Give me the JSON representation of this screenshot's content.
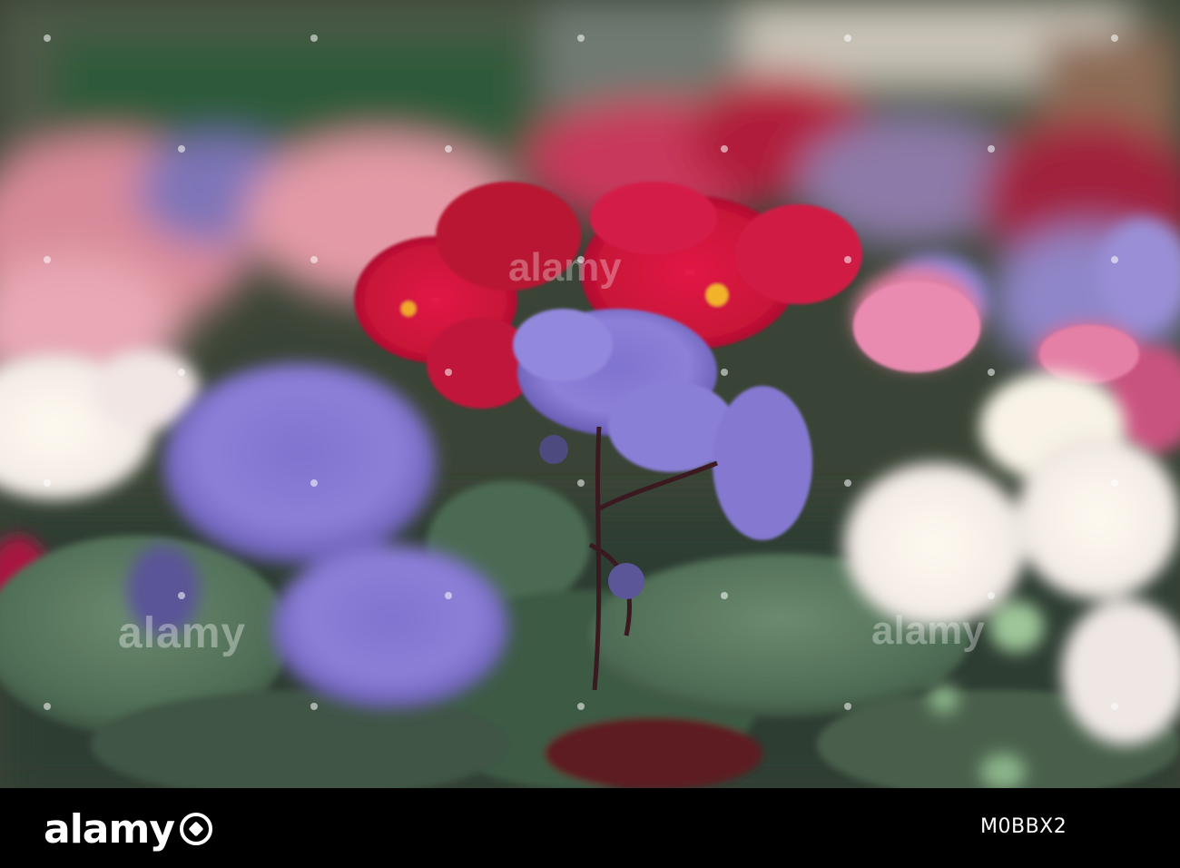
{
  "watermark": {
    "brand": "alamy",
    "image_id": "M0BBX2"
  }
}
